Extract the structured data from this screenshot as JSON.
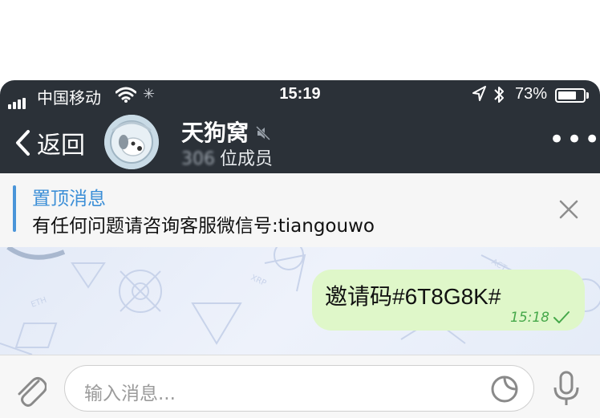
{
  "status_bar": {
    "carrier": "中国移动",
    "time": "15:19",
    "battery_percent": "73%",
    "battery_level": 0.73
  },
  "nav": {
    "back_label": "返回",
    "title": "天狗窝",
    "member_count_blurred": "306",
    "members_suffix": "位成员",
    "more_label": "•••"
  },
  "pinned": {
    "title": "置顶消息",
    "text": "有任何问题请咨询客服微信号:tiangouwo"
  },
  "chat": {
    "messages": [
      {
        "text": "邀请码#6T8G8K#",
        "time": "15:18",
        "status_icon": "check-icon",
        "outgoing": true
      }
    ]
  },
  "input": {
    "placeholder": "输入消息..."
  },
  "colors": {
    "header_bg": "#2b3138",
    "accent": "#3c8fd7",
    "bubble_out": "#dff7c9",
    "time_green": "#46a84a"
  }
}
